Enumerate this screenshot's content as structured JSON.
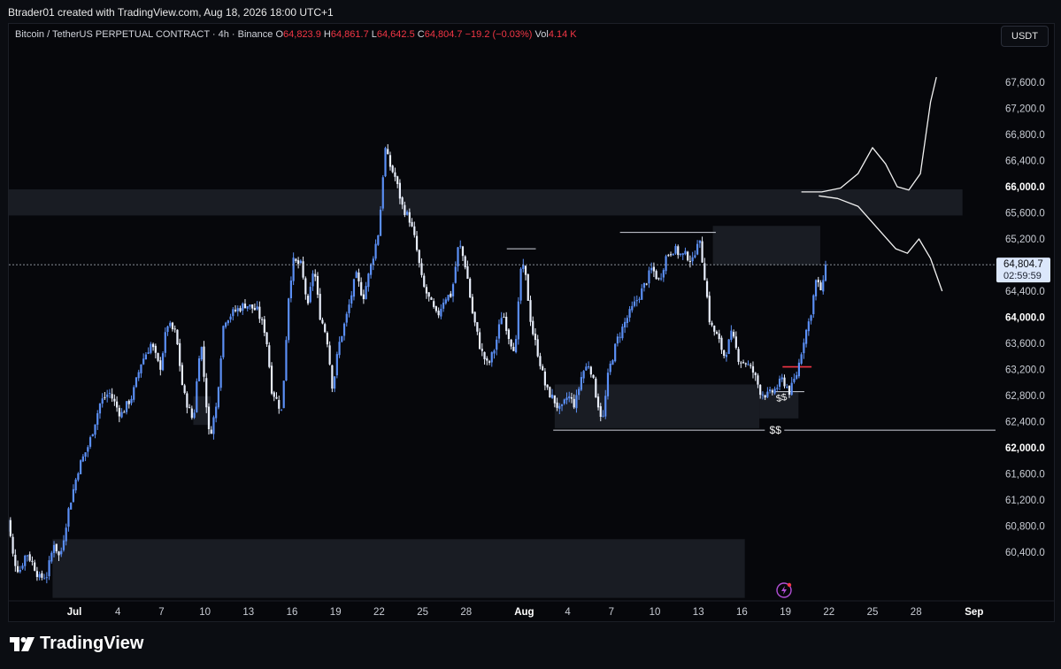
{
  "attribution": "Btrader01 created with TradingView.com, Aug 18, 2026 18:00 UTC+1",
  "legend": {
    "symbol": "Bitcoin / TetherUS PERPETUAL CONTRACT · 4h · Binance",
    "o_label": "O",
    "o_value": "64,823.9",
    "h_label": "H",
    "h_value": "64,861.7",
    "l_label": "L",
    "l_value": "64,642.5",
    "c_label": "C",
    "c_value": "64,804.7",
    "change": "−19.2 (−0.03%)",
    "vol_label": "Vol",
    "vol_value": "4.14 K"
  },
  "currency": "USDT",
  "price_badge": {
    "price": "64,804.7",
    "countdown": "02:59:59"
  },
  "annotations": {
    "liquidity_major": "$$",
    "liquidity_minor": "$$"
  },
  "brand": "TradingView",
  "colors": {
    "bull": "#5b8ff5",
    "bear": "#e8eefb",
    "down_text": "#f23645",
    "zone": "#1a1d25",
    "red_line": "#f23645"
  },
  "chart_data": {
    "type": "candlestick",
    "interval": "4h",
    "y_axis_ticks": [
      "67,600.0",
      "67,200.0",
      "66,800.0",
      "66,400.0",
      "66,000.0",
      "65,600.0",
      "65,200.0",
      "64,800.0",
      "64,400.0",
      "64,000.0",
      "63,600.0",
      "63,200.0",
      "62,800.0",
      "62,400.0",
      "62,000.0",
      "61,600.0",
      "61,200.0",
      "60,800.0",
      "60,400.0"
    ],
    "y_range": [
      60000,
      68400
    ],
    "x_axis_ticks": [
      "Jul",
      "4",
      "7",
      "10",
      "13",
      "16",
      "19",
      "22",
      "25",
      "28",
      "Aug",
      "4",
      "7",
      "10",
      "13",
      "16",
      "19",
      "22",
      "25",
      "28",
      "Sep"
    ],
    "last_close": 64804.7,
    "anchors": [
      {
        "day": -4.9,
        "price": 60450
      },
      {
        "day": -4.6,
        "price": 60950
      },
      {
        "day": -4.2,
        "price": 60300
      },
      {
        "day": -3.8,
        "price": 60100
      },
      {
        "day": -3.3,
        "price": 60400
      },
      {
        "day": -2.8,
        "price": 60200
      },
      {
        "day": -2.4,
        "price": 60000
      },
      {
        "day": -1.9,
        "price": 60050
      },
      {
        "day": -1.4,
        "price": 60550
      },
      {
        "day": -1.0,
        "price": 60300
      },
      {
        "day": -0.4,
        "price": 61050
      },
      {
        "day": 0.3,
        "price": 61700
      },
      {
        "day": 1.0,
        "price": 62050
      },
      {
        "day": 1.8,
        "price": 62700
      },
      {
        "day": 2.4,
        "price": 62850
      },
      {
        "day": 3.2,
        "price": 62500
      },
      {
        "day": 4.0,
        "price": 62800
      },
      {
        "day": 4.6,
        "price": 63300
      },
      {
        "day": 5.3,
        "price": 63600
      },
      {
        "day": 5.9,
        "price": 63200
      },
      {
        "day": 6.4,
        "price": 63900
      },
      {
        "day": 7.0,
        "price": 63750
      },
      {
        "day": 7.5,
        "price": 62850
      },
      {
        "day": 8.2,
        "price": 62400
      },
      {
        "day": 8.7,
        "price": 63700
      },
      {
        "day": 9.3,
        "price": 62150
      },
      {
        "day": 9.8,
        "price": 62650
      },
      {
        "day": 10.3,
        "price": 63950
      },
      {
        "day": 11.1,
        "price": 64100
      },
      {
        "day": 11.8,
        "price": 64200
      },
      {
        "day": 12.6,
        "price": 64100
      },
      {
        "day": 13.2,
        "price": 63750
      },
      {
        "day": 13.6,
        "price": 62900
      },
      {
        "day": 14.3,
        "price": 62550
      },
      {
        "day": 14.8,
        "price": 64450
      },
      {
        "day": 15.1,
        "price": 64850
      },
      {
        "day": 15.6,
        "price": 64800
      },
      {
        "day": 16.1,
        "price": 64150
      },
      {
        "day": 16.5,
        "price": 64800
      },
      {
        "day": 16.9,
        "price": 64050
      },
      {
        "day": 17.4,
        "price": 63700
      },
      {
        "day": 17.8,
        "price": 62900
      },
      {
        "day": 18.2,
        "price": 63550
      },
      {
        "day": 18.8,
        "price": 64050
      },
      {
        "day": 19.4,
        "price": 64650
      },
      {
        "day": 19.9,
        "price": 64300
      },
      {
        "day": 20.5,
        "price": 64850
      },
      {
        "day": 21.0,
        "price": 65350
      },
      {
        "day": 21.4,
        "price": 66600
      },
      {
        "day": 21.7,
        "price": 66350
      },
      {
        "day": 22.1,
        "price": 66150
      },
      {
        "day": 22.6,
        "price": 65700
      },
      {
        "day": 23.1,
        "price": 65500
      },
      {
        "day": 23.5,
        "price": 65150
      },
      {
        "day": 24.0,
        "price": 64500
      },
      {
        "day": 24.5,
        "price": 64250
      },
      {
        "day": 25.0,
        "price": 64000
      },
      {
        "day": 25.5,
        "price": 64300
      },
      {
        "day": 26.0,
        "price": 64350
      },
      {
        "day": 26.5,
        "price": 65150
      },
      {
        "day": 27.0,
        "price": 64750
      },
      {
        "day": 27.4,
        "price": 64100
      },
      {
        "day": 28.0,
        "price": 63500
      },
      {
        "day": 28.5,
        "price": 63250
      },
      {
        "day": 29.0,
        "price": 63550
      },
      {
        "day": 29.5,
        "price": 64100
      },
      {
        "day": 30.0,
        "price": 63650
      },
      {
        "day": 30.4,
        "price": 63500
      },
      {
        "day": 30.8,
        "price": 64850
      },
      {
        "day": 31.1,
        "price": 64600
      },
      {
        "day": 31.5,
        "price": 63850
      },
      {
        "day": 32.0,
        "price": 63400
      },
      {
        "day": 32.5,
        "price": 62900
      },
      {
        "day": 33.0,
        "price": 62750
      },
      {
        "day": 33.5,
        "price": 62550
      },
      {
        "day": 34.0,
        "price": 62800
      },
      {
        "day": 34.5,
        "price": 62650
      },
      {
        "day": 35.0,
        "price": 63150
      },
      {
        "day": 35.5,
        "price": 63300
      },
      {
        "day": 36.0,
        "price": 62750
      },
      {
        "day": 36.4,
        "price": 62400
      },
      {
        "day": 36.8,
        "price": 63150
      },
      {
        "day": 37.4,
        "price": 63650
      },
      {
        "day": 38.0,
        "price": 63950
      },
      {
        "day": 38.6,
        "price": 64200
      },
      {
        "day": 39.2,
        "price": 64450
      },
      {
        "day": 39.8,
        "price": 64750
      },
      {
        "day": 40.3,
        "price": 64550
      },
      {
        "day": 40.8,
        "price": 64950
      },
      {
        "day": 41.3,
        "price": 65050
      },
      {
        "day": 41.8,
        "price": 64950
      },
      {
        "day": 42.2,
        "price": 64950
      },
      {
        "day": 42.6,
        "price": 64850
      },
      {
        "day": 43.0,
        "price": 65250
      },
      {
        "day": 43.4,
        "price": 64700
      },
      {
        "day": 43.8,
        "price": 63900
      },
      {
        "day": 44.3,
        "price": 63700
      },
      {
        "day": 44.8,
        "price": 63400
      },
      {
        "day": 45.3,
        "price": 63750
      },
      {
        "day": 45.8,
        "price": 63350
      },
      {
        "day": 46.3,
        "price": 63300
      },
      {
        "day": 46.8,
        "price": 63150
      },
      {
        "day": 47.3,
        "price": 62850
      },
      {
        "day": 47.8,
        "price": 62800
      },
      {
        "day": 48.3,
        "price": 62900
      },
      {
        "day": 48.8,
        "price": 63050
      },
      {
        "day": 49.3,
        "price": 62850
      },
      {
        "day": 49.8,
        "price": 63150
      },
      {
        "day": 50.3,
        "price": 63700
      },
      {
        "day": 50.7,
        "price": 64000
      },
      {
        "day": 51.1,
        "price": 64550
      },
      {
        "day": 51.5,
        "price": 64400
      },
      {
        "day": 51.9,
        "price": 64804.7
      }
    ],
    "zones": [
      {
        "name": "upper-supply",
        "from_day": -5.8,
        "to_day": 61.2,
        "low": 65560,
        "high": 65960
      },
      {
        "name": "local-supply",
        "from_day": 44.0,
        "to_day": 51.4,
        "low": 64800,
        "high": 65400
      },
      {
        "name": "demand-aug",
        "from_day": 33.1,
        "to_day": 47.2,
        "low": 62300,
        "high": 62970
      },
      {
        "name": "demand-mid-aug",
        "from_day": 47.2,
        "to_day": 49.9,
        "low": 62450,
        "high": 62850
      },
      {
        "name": "demand-early-jul",
        "from_day": -1.5,
        "to_day": 46.2,
        "low": 59700,
        "high": 60600
      },
      {
        "name": "demand-small-jul",
        "from_day": 8.2,
        "to_day": 9.4,
        "low": 62350,
        "high": 62790
      }
    ],
    "levels": [
      {
        "name": "swing-high-eq",
        "from_day": 37.6,
        "to_day": 44.2,
        "price": 65300
      },
      {
        "name": "swing-high-jul",
        "from_day": 29.8,
        "to_day": 31.8,
        "price": 65050
      },
      {
        "name": "liquidity-low",
        "from_day": 33.0,
        "to_day": 64.2,
        "price": 62270
      },
      {
        "name": "range-low",
        "from_day": 48.3,
        "to_day": 50.3,
        "price": 62860
      }
    ],
    "red_level": {
      "from_day": 48.8,
      "to_day": 50.8,
      "price": 63240
    },
    "projections": [
      [
        [
          50.1,
          65920
        ],
        [
          51.5,
          65920
        ],
        [
          52.8,
          65980
        ],
        [
          54.0,
          66200
        ],
        [
          55.0,
          66600
        ],
        [
          55.9,
          66350
        ],
        [
          56.7,
          66000
        ],
        [
          57.5,
          65950
        ],
        [
          58.3,
          66200
        ],
        [
          59.0,
          67300
        ],
        [
          59.4,
          67680
        ]
      ],
      [
        [
          51.3,
          65860
        ],
        [
          52.6,
          65820
        ],
        [
          54.0,
          65700
        ],
        [
          55.0,
          65450
        ],
        [
          55.8,
          65250
        ],
        [
          56.6,
          65050
        ],
        [
          57.4,
          64980
        ],
        [
          58.2,
          65200
        ],
        [
          59.0,
          64900
        ],
        [
          59.8,
          64400
        ]
      ]
    ]
  }
}
